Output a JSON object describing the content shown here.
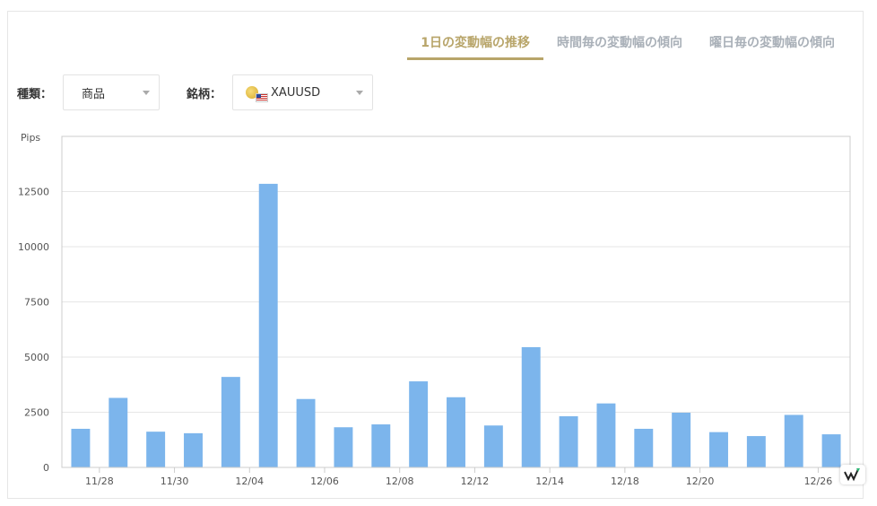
{
  "tabs": [
    {
      "label": "1日の変動幅の推移",
      "active": true
    },
    {
      "label": "時間毎の変動幅の傾向",
      "active": false
    },
    {
      "label": "曜日毎の変動幅の傾向",
      "active": false
    }
  ],
  "filters": {
    "type_label": "種類：",
    "type_value": "商品",
    "symbol_label": "銘柄：",
    "symbol_value": "XAUUSD",
    "symbol_icon": "gold-coin-us-flag-icon"
  },
  "colors": {
    "bar": "#7cb5ec",
    "accent": "#b8a56a",
    "tab_inactive": "#a9b0b8"
  },
  "chart_data": {
    "type": "bar",
    "ylabel": "Pips",
    "ylim": [
      0,
      15000
    ],
    "yticks": [
      0,
      2500,
      5000,
      7500,
      10000,
      12500
    ],
    "grid": true,
    "x_tick_labels": [
      "11/28",
      "11/30",
      "12/04",
      "12/06",
      "12/08",
      "12/12",
      "12/14",
      "12/18",
      "12/20",
      "12/26"
    ],
    "x_tick_label_bar_index": [
      1,
      3,
      5,
      7,
      9,
      11,
      13,
      15,
      17,
      20
    ],
    "values": [
      1750,
      3150,
      1620,
      1550,
      4100,
      12850,
      3100,
      1820,
      1950,
      3900,
      3180,
      1900,
      5450,
      2320,
      2900,
      1750,
      2480,
      1600,
      1420,
      2380,
      1500
    ]
  }
}
